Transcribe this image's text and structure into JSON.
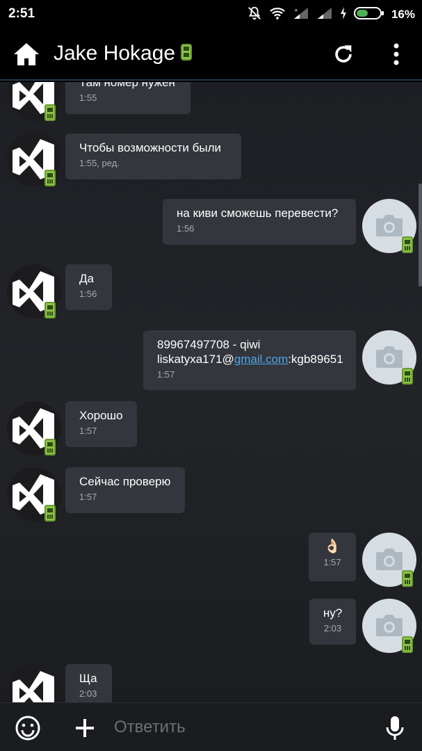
{
  "status_bar": {
    "time": "2:51",
    "battery_percent": "16%",
    "icons": [
      "mute-icon",
      "wifi-icon",
      "signal-icon",
      "signal-icon",
      "charging-icon",
      "battery-icon"
    ]
  },
  "header": {
    "title": "Jake Hokage",
    "status_icon": "mobile-phone-icon",
    "home_icon": "home-icon",
    "refresh_icon": "refresh-icon",
    "menu_icon": "more-vertical-icon"
  },
  "messages": [
    {
      "direction": "in",
      "text": "Там номер нужен",
      "time": "1:55"
    },
    {
      "direction": "in",
      "text": "Чтобы возможности были",
      "time": "1:55, ред."
    },
    {
      "direction": "out",
      "text": "на киви сможешь перевести?",
      "time": "1:56"
    },
    {
      "direction": "in",
      "text": "Да",
      "time": "1:56"
    },
    {
      "direction": "out",
      "text_line1": "89967497708 - qiwi",
      "text_pre": "liskatyxa171@",
      "text_link": "gmail.com",
      "text_post": ":kgb89651",
      "time": "1:57"
    },
    {
      "direction": "in",
      "text": "Хорошо",
      "time": "1:57"
    },
    {
      "direction": "in",
      "text": "Сейчас проверю",
      "time": "1:57"
    },
    {
      "direction": "out",
      "text": "👌🏻",
      "time": "1:57"
    },
    {
      "direction": "out",
      "text": "ну?",
      "time": "2:03"
    },
    {
      "direction": "in",
      "text": "Ща",
      "time": "2:03"
    }
  ],
  "input_bar": {
    "placeholder": "Ответить",
    "emoji_icon": "emoji-icon",
    "add_icon": "plus-icon",
    "mic_icon": "microphone-icon"
  },
  "colors": {
    "background": "#000000",
    "chat_background": "#1f2125",
    "bubble": "#33363c",
    "link": "#4ca6e8",
    "badge_green": "#8bc34a",
    "header_divider": "#27394a"
  }
}
